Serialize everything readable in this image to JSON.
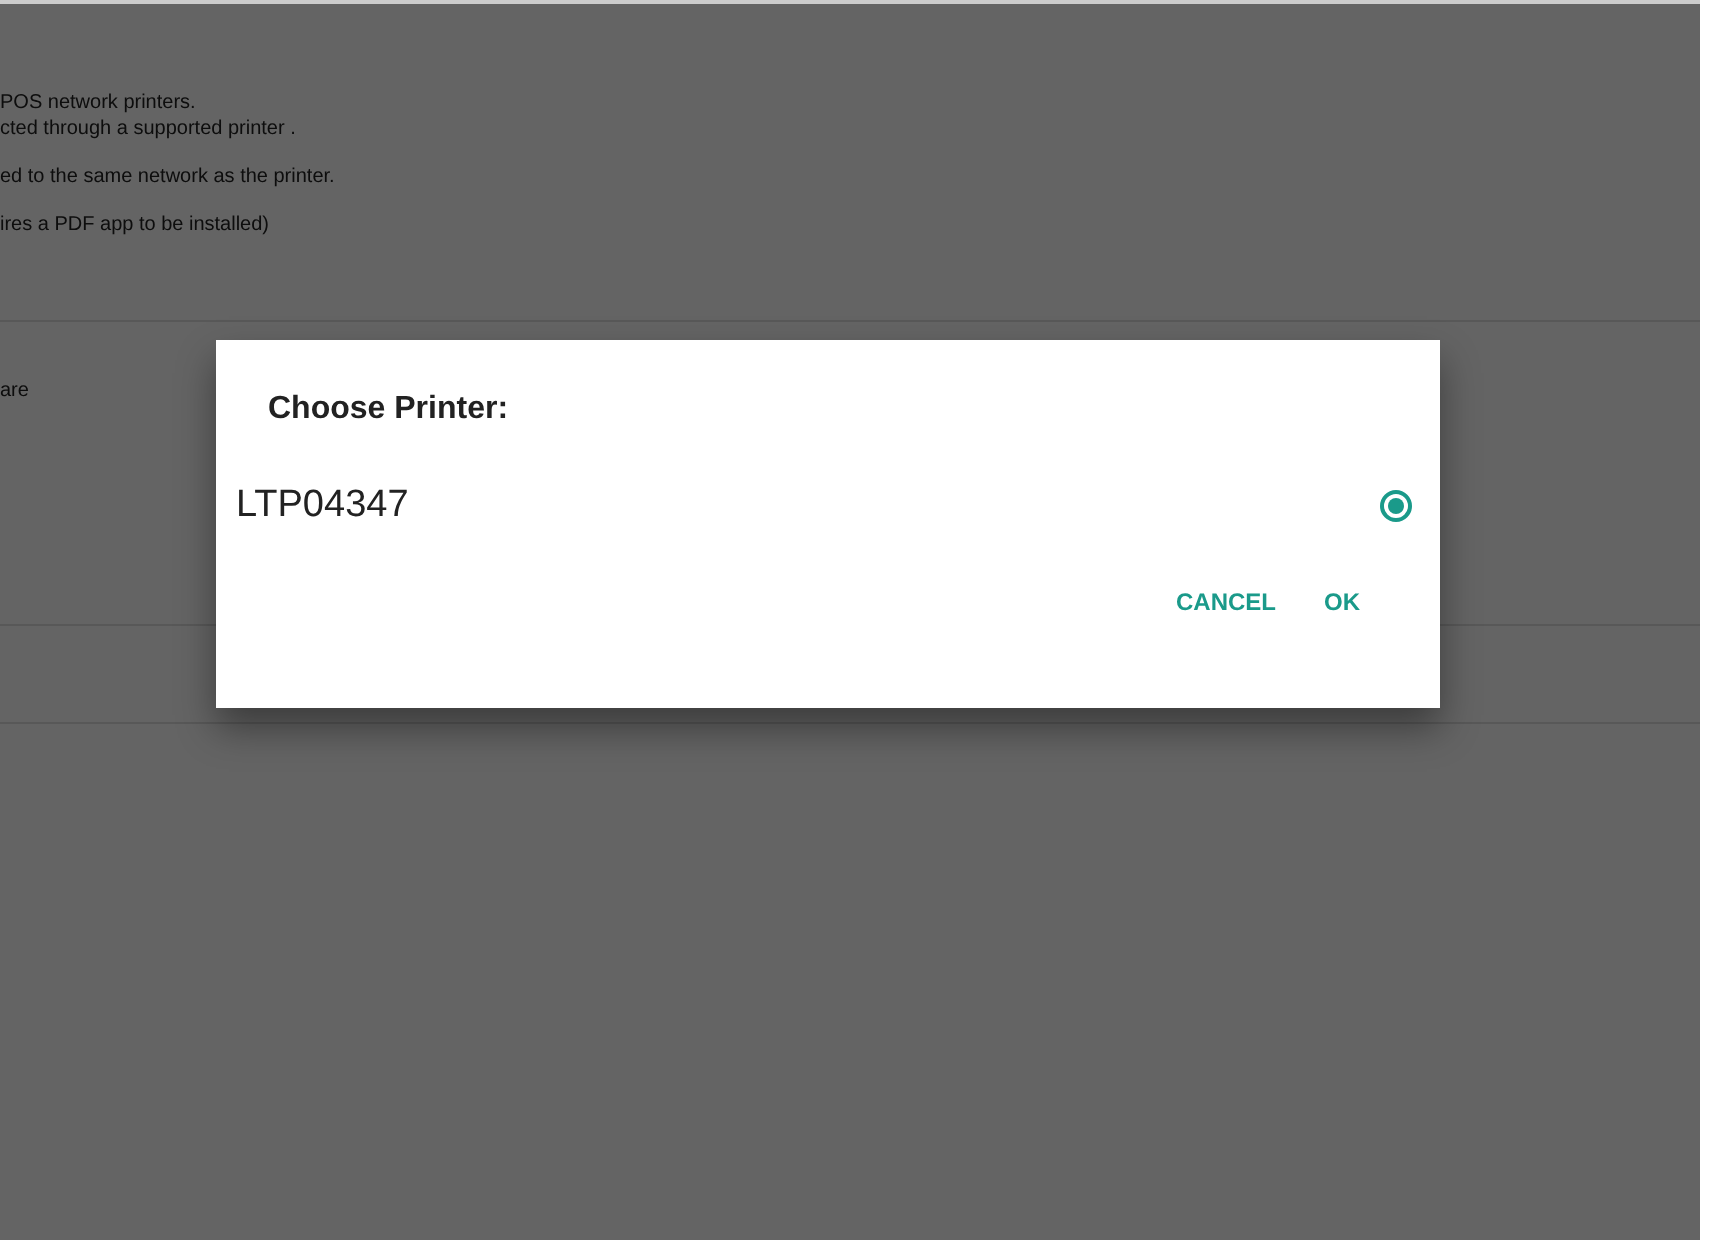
{
  "background": {
    "lines": [
      "POS network printers.",
      "cted through a supported printer .",
      "ed to the same network as the printer.",
      "ires a PDF app to be installed)"
    ],
    "row_label": "are"
  },
  "dialog": {
    "title": "Choose Printer:",
    "options": [
      {
        "label": "LTP04347",
        "selected": true
      }
    ],
    "buttons": [
      "CANCEL",
      "OK"
    ]
  }
}
